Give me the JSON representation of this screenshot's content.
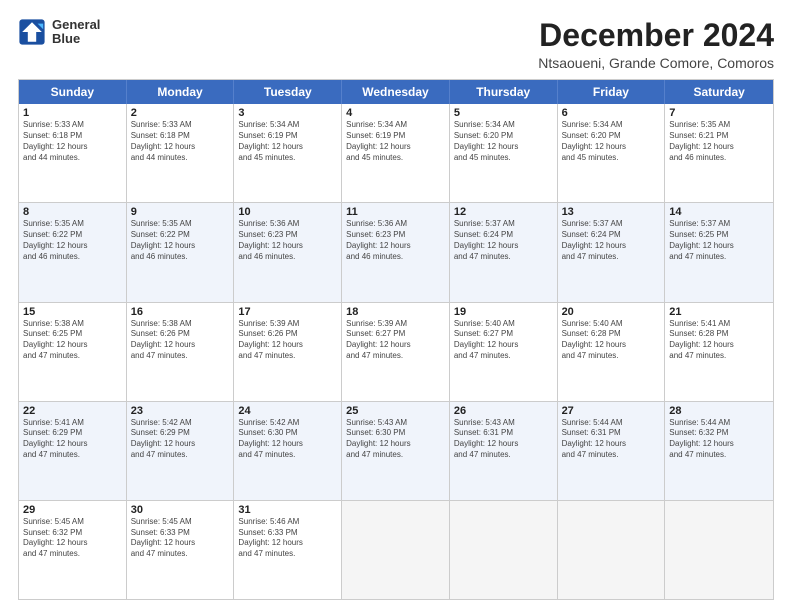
{
  "logo": {
    "line1": "General",
    "line2": "Blue"
  },
  "title": "December 2024",
  "location": "Ntsaoueni, Grande Comore, Comoros",
  "weekdays": [
    "Sunday",
    "Monday",
    "Tuesday",
    "Wednesday",
    "Thursday",
    "Friday",
    "Saturday"
  ],
  "rows": [
    [
      {
        "day": "1",
        "info": "Sunrise: 5:33 AM\nSunset: 6:18 PM\nDaylight: 12 hours\nand 44 minutes."
      },
      {
        "day": "2",
        "info": "Sunrise: 5:33 AM\nSunset: 6:18 PM\nDaylight: 12 hours\nand 44 minutes."
      },
      {
        "day": "3",
        "info": "Sunrise: 5:34 AM\nSunset: 6:19 PM\nDaylight: 12 hours\nand 45 minutes."
      },
      {
        "day": "4",
        "info": "Sunrise: 5:34 AM\nSunset: 6:19 PM\nDaylight: 12 hours\nand 45 minutes."
      },
      {
        "day": "5",
        "info": "Sunrise: 5:34 AM\nSunset: 6:20 PM\nDaylight: 12 hours\nand 45 minutes."
      },
      {
        "day": "6",
        "info": "Sunrise: 5:34 AM\nSunset: 6:20 PM\nDaylight: 12 hours\nand 45 minutes."
      },
      {
        "day": "7",
        "info": "Sunrise: 5:35 AM\nSunset: 6:21 PM\nDaylight: 12 hours\nand 46 minutes."
      }
    ],
    [
      {
        "day": "8",
        "info": "Sunrise: 5:35 AM\nSunset: 6:22 PM\nDaylight: 12 hours\nand 46 minutes."
      },
      {
        "day": "9",
        "info": "Sunrise: 5:35 AM\nSunset: 6:22 PM\nDaylight: 12 hours\nand 46 minutes."
      },
      {
        "day": "10",
        "info": "Sunrise: 5:36 AM\nSunset: 6:23 PM\nDaylight: 12 hours\nand 46 minutes."
      },
      {
        "day": "11",
        "info": "Sunrise: 5:36 AM\nSunset: 6:23 PM\nDaylight: 12 hours\nand 46 minutes."
      },
      {
        "day": "12",
        "info": "Sunrise: 5:37 AM\nSunset: 6:24 PM\nDaylight: 12 hours\nand 47 minutes."
      },
      {
        "day": "13",
        "info": "Sunrise: 5:37 AM\nSunset: 6:24 PM\nDaylight: 12 hours\nand 47 minutes."
      },
      {
        "day": "14",
        "info": "Sunrise: 5:37 AM\nSunset: 6:25 PM\nDaylight: 12 hours\nand 47 minutes."
      }
    ],
    [
      {
        "day": "15",
        "info": "Sunrise: 5:38 AM\nSunset: 6:25 PM\nDaylight: 12 hours\nand 47 minutes."
      },
      {
        "day": "16",
        "info": "Sunrise: 5:38 AM\nSunset: 6:26 PM\nDaylight: 12 hours\nand 47 minutes."
      },
      {
        "day": "17",
        "info": "Sunrise: 5:39 AM\nSunset: 6:26 PM\nDaylight: 12 hours\nand 47 minutes."
      },
      {
        "day": "18",
        "info": "Sunrise: 5:39 AM\nSunset: 6:27 PM\nDaylight: 12 hours\nand 47 minutes."
      },
      {
        "day": "19",
        "info": "Sunrise: 5:40 AM\nSunset: 6:27 PM\nDaylight: 12 hours\nand 47 minutes."
      },
      {
        "day": "20",
        "info": "Sunrise: 5:40 AM\nSunset: 6:28 PM\nDaylight: 12 hours\nand 47 minutes."
      },
      {
        "day": "21",
        "info": "Sunrise: 5:41 AM\nSunset: 6:28 PM\nDaylight: 12 hours\nand 47 minutes."
      }
    ],
    [
      {
        "day": "22",
        "info": "Sunrise: 5:41 AM\nSunset: 6:29 PM\nDaylight: 12 hours\nand 47 minutes."
      },
      {
        "day": "23",
        "info": "Sunrise: 5:42 AM\nSunset: 6:29 PM\nDaylight: 12 hours\nand 47 minutes."
      },
      {
        "day": "24",
        "info": "Sunrise: 5:42 AM\nSunset: 6:30 PM\nDaylight: 12 hours\nand 47 minutes."
      },
      {
        "day": "25",
        "info": "Sunrise: 5:43 AM\nSunset: 6:30 PM\nDaylight: 12 hours\nand 47 minutes."
      },
      {
        "day": "26",
        "info": "Sunrise: 5:43 AM\nSunset: 6:31 PM\nDaylight: 12 hours\nand 47 minutes."
      },
      {
        "day": "27",
        "info": "Sunrise: 5:44 AM\nSunset: 6:31 PM\nDaylight: 12 hours\nand 47 minutes."
      },
      {
        "day": "28",
        "info": "Sunrise: 5:44 AM\nSunset: 6:32 PM\nDaylight: 12 hours\nand 47 minutes."
      }
    ],
    [
      {
        "day": "29",
        "info": "Sunrise: 5:45 AM\nSunset: 6:32 PM\nDaylight: 12 hours\nand 47 minutes."
      },
      {
        "day": "30",
        "info": "Sunrise: 5:45 AM\nSunset: 6:33 PM\nDaylight: 12 hours\nand 47 minutes."
      },
      {
        "day": "31",
        "info": "Sunrise: 5:46 AM\nSunset: 6:33 PM\nDaylight: 12 hours\nand 47 minutes."
      },
      null,
      null,
      null,
      null
    ]
  ]
}
